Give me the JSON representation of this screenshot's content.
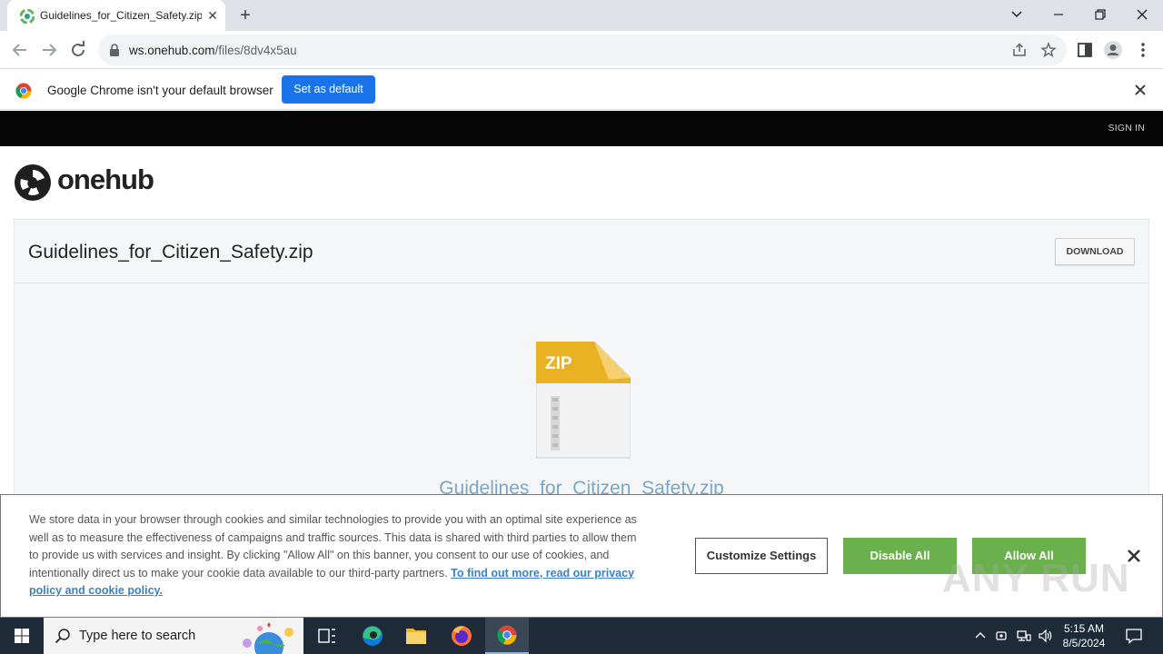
{
  "browser": {
    "tab_title": "Guidelines_for_Citizen_Safety.zip",
    "url_host": "ws.onehub.com",
    "url_path": "/files/8dv4x5au"
  },
  "infobar": {
    "message": "Google Chrome isn't your default browser",
    "set_default_label": "Set as default"
  },
  "site": {
    "signin_label": "SIGN IN",
    "logo_text": "onehub"
  },
  "file": {
    "title": "Guidelines_for_Citizen_Safety.zip",
    "download_label": "DOWNLOAD",
    "icon_label": "ZIP",
    "caption": "Guidelines_for_Citizen_Safety.zip"
  },
  "cookie_banner": {
    "text": "We store data in your browser through cookies and similar technologies to provide you with an optimal site experience as well as to measure the effectiveness of campaigns and traffic sources. This data is shared with third parties to allow them to provide us with services and insight. By clicking \"Allow All\" on this banner, you consent to our use of cookies, and intentionally direct us to make your cookie data available to our third-party partners.",
    "link_text": "To find out more, read our privacy policy and cookie policy.",
    "customize_label": "Customize Settings",
    "disable_label": "Disable All",
    "allow_label": "Allow All"
  },
  "watermark": "ANY RUN",
  "taskbar": {
    "search_placeholder": "Type here to search",
    "time": "5:15 AM",
    "date": "8/5/2024"
  },
  "colors": {
    "chrome_blue": "#1a73e8",
    "cookie_green": "#6ab04c",
    "zip_gold": "#e8b222",
    "caption_blue": "#79a7c7"
  }
}
